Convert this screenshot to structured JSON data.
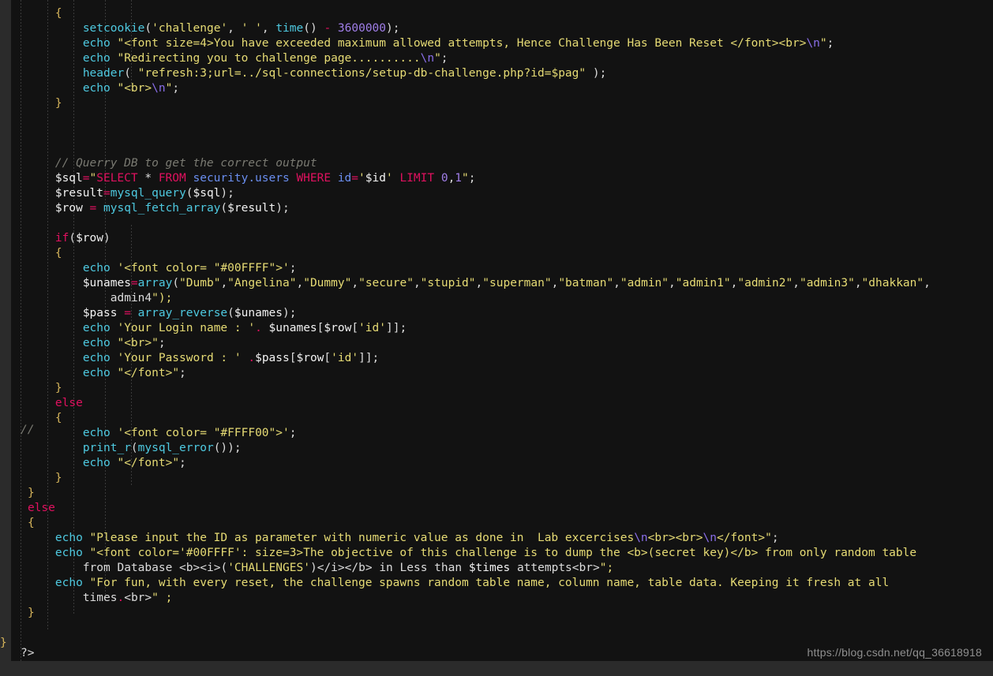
{
  "window": {
    "background_color": "#121212",
    "gutter_color": "#2b2b2b",
    "language": "php"
  },
  "watermark": {
    "text": "https://blog.csdn.net/qq_36618918"
  },
  "gutter": {
    "side_comment": "//",
    "php_close_tag": "?>"
  },
  "theme": {
    "keyword": "#e0115f",
    "function": "#4ec9e0",
    "string": "#e6db74",
    "variable": "#f2f2f2",
    "number": "#a07ee8",
    "comment": "#7a7a72",
    "brace": "#d4b35a",
    "namespace": "#6a8ef0",
    "background": "#121212",
    "foreground": "#e8e8e8"
  },
  "code": {
    "title": "setup-db-challenge source",
    "lines": [
      "        {",
      "            setcookie('challenge', ' ', time() - 3600000);",
      "            echo \"<font size=4>You have exceeded maximum allowed attempts, Hence Challenge Has Been Reset </font><br>\\n\";",
      "            echo \"Redirecting you to challenge page..........\\n\";",
      "            header( \"refresh:3;url=../sql-connections/setup-db-challenge.php?id=$pag\" );",
      "            echo \"<br>\\n\";",
      "        }",
      "",
      "",
      "",
      "        // Querry DB to get the correct output",
      "        $sql=\"SELECT * FROM security.users WHERE id='$id' LIMIT 0,1\";",
      "        $result=mysql_query($sql);",
      "        $row = mysql_fetch_array($result);",
      "",
      "        if($row)",
      "        {",
      "            echo '<font color= \"#00FFFF\">';",
      "            $unames=array(\"Dumb\",\"Angelina\",\"Dummy\",\"secure\",\"stupid\",\"superman\",\"batman\",\"admin\",\"admin1\",\"admin2\",\"admin3\",\"dhakkan\",",
      "                admin4\");",
      "            $pass = array_reverse($unames);",
      "            echo 'Your Login name : '. $unames[$row['id']];",
      "            echo \"<br>\";",
      "            echo 'Your Password : ' .$pass[$row['id']];",
      "            echo \"</font>\";",
      "        }",
      "        else",
      "        {",
      "            echo '<font color= \"#FFFF00\">';",
      "            print_r(mysql_error());",
      "            echo \"</font>\";",
      "        }",
      "    }",
      "    else",
      "    {",
      "        echo \"Please input the ID as parameter with numeric value as done in  Lab excercises\\n<br><br>\\n</font>\";",
      "        echo \"<font color='#00FFFF': size=3>The objective of this challenge is to dump the <b>(secret key)</b> from only random table",
      "            from Database <b><i>('CHALLENGES')</i></b> in Less than $times attempts<br>\";",
      "        echo \"For fun, with every reset, the challenge spawns random table name, column name, table data. Keeping it fresh at all",
      "            times.<br>\" ;",
      "    }",
      "",
      "}"
    ]
  }
}
